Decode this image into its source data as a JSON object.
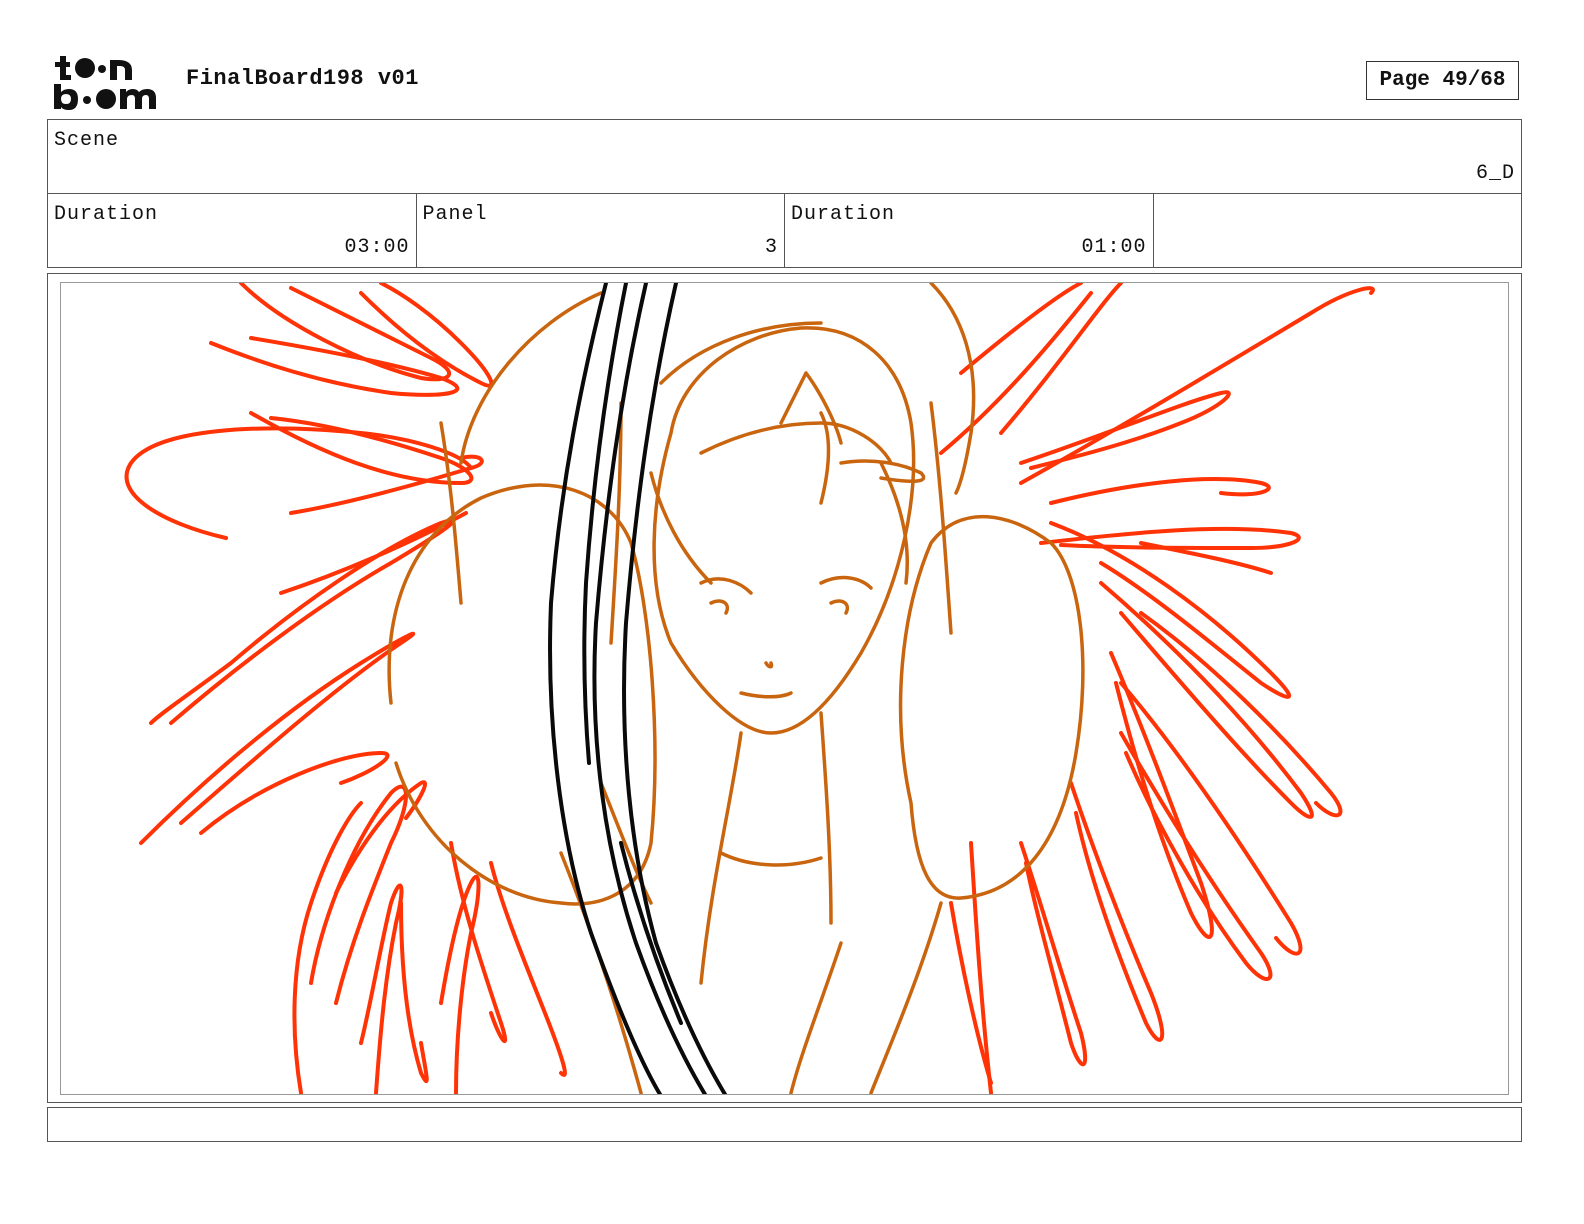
{
  "header": {
    "logo_text": "toon boom",
    "title": "FinalBoard198 v01",
    "page_label": "Page 49/68"
  },
  "scene": {
    "label": "Scene",
    "value": "6_D"
  },
  "info": {
    "scene_duration_label": "Duration",
    "scene_duration_value": "03:00",
    "panel_label": "Panel",
    "panel_value": "3",
    "panel_duration_label": "Duration",
    "panel_duration_value": "01:00"
  },
  "colors": {
    "sketch_orange": "#c9650f",
    "sketch_red": "#ff3306",
    "sketch_black": "#0a0a0a"
  },
  "notes": {
    "text": ""
  }
}
